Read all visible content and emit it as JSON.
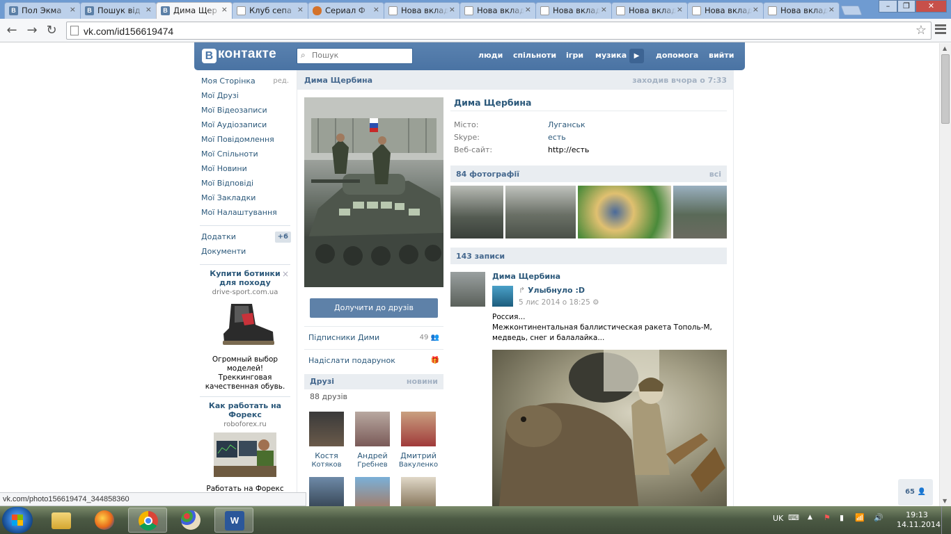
{
  "browser": {
    "tabs": [
      {
        "title": "Пол Экма",
        "icon": "vk"
      },
      {
        "title": "Пошук від",
        "icon": "vk"
      },
      {
        "title": "Дима Щер",
        "icon": "vk",
        "active": true
      },
      {
        "title": "Клуб сепа",
        "icon": "doc"
      },
      {
        "title": "Сериал Ф",
        "icon": "cat"
      },
      {
        "title": "Нова вкладка",
        "icon": "doc"
      },
      {
        "title": "Нова вкладка",
        "icon": "doc"
      },
      {
        "title": "Нова вкладка",
        "icon": "doc"
      },
      {
        "title": "Нова вкладка",
        "icon": "doc"
      },
      {
        "title": "Нова вкладка",
        "icon": "doc"
      },
      {
        "title": "Нова вкладка",
        "icon": "doc"
      }
    ],
    "tab_close": "×",
    "url": "vk.com/id156619474",
    "star": "☆",
    "status_url": "vk.com/photo156619474_344858360"
  },
  "vk": {
    "logo": "контакте",
    "logo_b": "В",
    "search_placeholder": "Пошук",
    "nav": [
      "люди",
      "спільноти",
      "ігри",
      "музика",
      "допомога",
      "вийти"
    ],
    "left_menu": [
      "Моя Сторінка",
      "Мої Друзі",
      "Мої Відеозаписи",
      "Мої Аудіозаписи",
      "Мої Повідомлення",
      "Мої Спільноти",
      "Мої Новини",
      "Мої Відповіді",
      "Мої Закладки",
      "Мої Налаштування"
    ],
    "edit_label": "ред.",
    "apps_label": "Додатки",
    "apps_count": "+6",
    "docs_label": "Документи",
    "ads": [
      {
        "title": "Купити ботинки для походу",
        "domain": "drive-sport.com.ua",
        "text": "Огромный выбор моделей! Треккинговая качественная обувь."
      },
      {
        "title": "Как работать на Форекс",
        "domain": "roboforex.ru",
        "text": "Работать на Форекс"
      }
    ],
    "ad_close": "×"
  },
  "profile": {
    "header_name": "Дима Щербина",
    "last_seen": "заходив вчора о 7:33",
    "name": "Дима Щербина",
    "info": [
      {
        "key": "Місто:",
        "value": "Луганськ"
      },
      {
        "key": "Skype:",
        "value": "есть"
      },
      {
        "key": "Веб-сайт:",
        "value": "http://есть"
      }
    ],
    "add_friend": "Долучити до друзів",
    "followers_label": "Підписники Дими",
    "followers_count": "49",
    "gift_label": "Надіслати подарунок",
    "friends_title": "Друзі",
    "friends_news": "новини",
    "friends_count": "88 друзів",
    "friends": [
      {
        "first": "Костя",
        "last": "Котяков"
      },
      {
        "first": "Андрей",
        "last": "Гребнев"
      },
      {
        "first": "Дмитрий",
        "last": "Вакуленко"
      }
    ],
    "photos_title": "84 фотографії",
    "photos_all": "всі",
    "posts_title": "143 записи",
    "post": {
      "author": "Дима Щербина",
      "repost_from": "Улыбнуло :D",
      "date": "5 лис 2014 о 18:25",
      "text1": "Россия...",
      "text2": "Межконтинентальная баллистическая ракета Тополь-М, медведь, снег и балалайка..."
    },
    "online_count": "65"
  },
  "taskbar": {
    "lang": "UK",
    "time": "19:13",
    "date": "14.11.2014"
  }
}
